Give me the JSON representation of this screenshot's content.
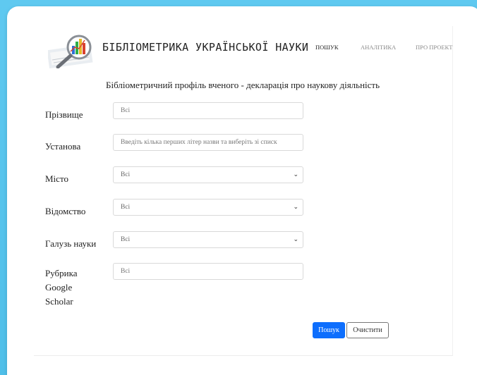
{
  "header": {
    "brand": "БІБЛІОМЕТРИКА УКРАЇНСЬКОЇ НАУКИ",
    "nav": [
      "ПОШУК",
      "АНАЛІТИКА",
      "ПРО ПРОЕКТ"
    ],
    "logo_icon": "magnifier-chart-logo"
  },
  "page_title": "Бібліометричний профіль вченого - декларація про наукову діяльність",
  "form": {
    "surname": {
      "label": "Прізвище",
      "value": "Всі"
    },
    "institution": {
      "label": "Установа",
      "placeholder": "Введіть кілька перших літер назви та виберіть зі списк"
    },
    "city": {
      "label": "Місто",
      "value": "Всі"
    },
    "department": {
      "label": "Відомство",
      "value": "Всі"
    },
    "science_field": {
      "label": "Галузь науки",
      "value": "Всі"
    },
    "rubric": {
      "label_lines": [
        "Рубрика",
        "Google",
        "Scholar"
      ],
      "value": "Всі"
    }
  },
  "buttons": {
    "search": "Пошук",
    "clear": "Очистити"
  },
  "colors": {
    "background": "#4fbfe9",
    "primary": "#0d6efd"
  }
}
